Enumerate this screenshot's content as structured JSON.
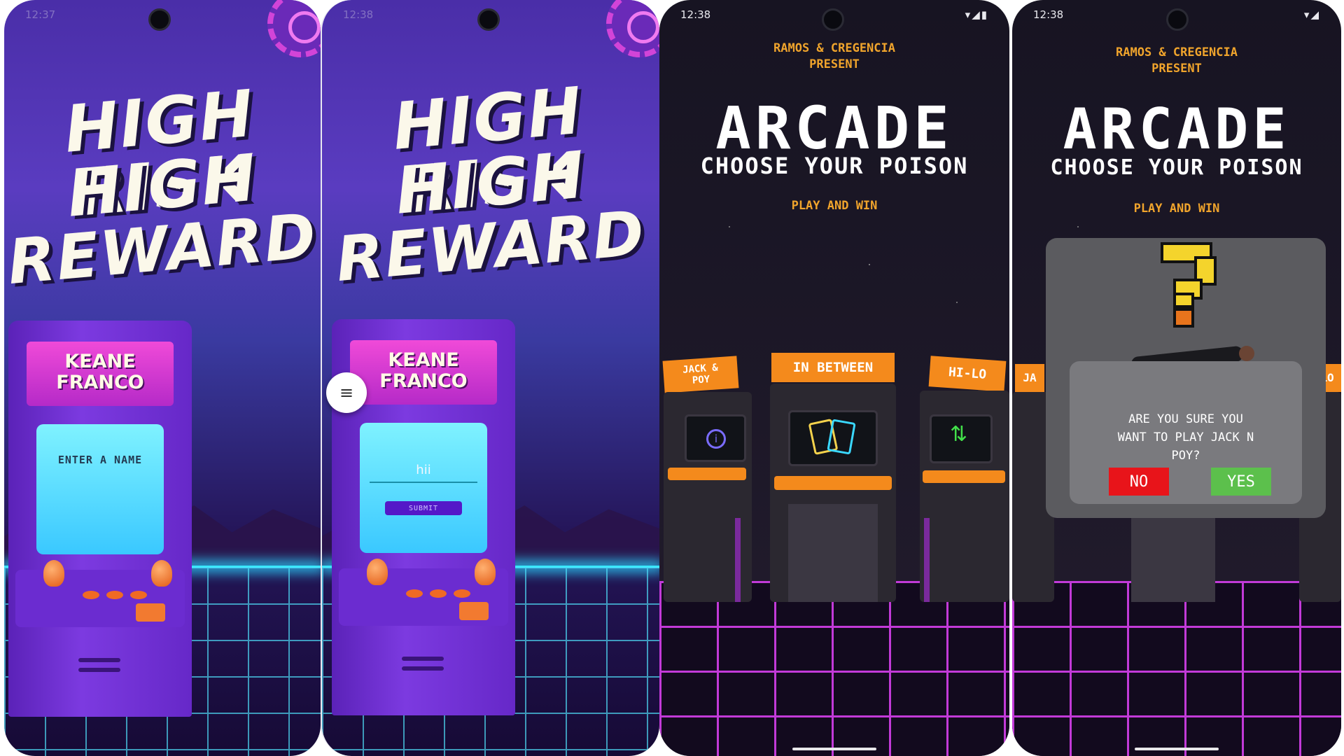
{
  "screens": [
    {
      "title_lines": [
        "HIGH RISK",
        "HIGH",
        "REWARD"
      ],
      "cabinet_label_lines": [
        "KEANE",
        "FRANCO"
      ],
      "screen_prompt": "ENTER A NAME",
      "status_time": "12:37"
    },
    {
      "title_lines": [
        "HIGH RISK",
        "HIGH",
        "REWARD"
      ],
      "cabinet_label_lines": [
        "KEANE",
        "FRANCO"
      ],
      "name_input_value": "hii",
      "submit_label": "SUBMIT",
      "menu_icon_glyph": "≡",
      "status_time": "12:38"
    },
    {
      "status_time": "12:38",
      "present_lines": [
        "RAMOS & CREGENCIA",
        "PRESENT"
      ],
      "title": "ARCADE",
      "subtitle": "CHOOSE YOUR POISON",
      "tagline": "PLAY AND WIN",
      "games": [
        {
          "label_lines": [
            "JACK &",
            "POY"
          ],
          "icon": "info-icon"
        },
        {
          "label_lines": [
            "IN BETWEEN"
          ],
          "icon": "cards-icon"
        },
        {
          "label_lines": [
            "HI-LO"
          ],
          "icon": "up-down-arrows-icon"
        }
      ]
    },
    {
      "status_time": "12:38",
      "present_lines": [
        "RAMOS & CREGENCIA",
        "PRESENT"
      ],
      "title": "ARCADE",
      "subtitle": "CHOOSE YOUR POISON",
      "tagline": "PLAY AND WIN",
      "dialog": {
        "question_lines": [
          "ARE YOU SURE YOU",
          "WANT TO PLAY JACK N",
          "POY?"
        ],
        "no_label": "NO",
        "yes_label": "YES"
      },
      "partial_labels": [
        "JA",
        "LO"
      ]
    }
  ],
  "colors": {
    "accent_orange": "#f0a42c",
    "neon_cyan": "#38e8ff",
    "neon_magenta": "#c23ad8",
    "no_red": "#e8141a",
    "yes_green": "#5cc04c"
  }
}
